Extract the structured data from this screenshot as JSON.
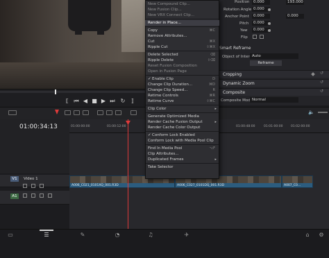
{
  "inspector": {
    "position": {
      "label": "Position",
      "x": "0.000",
      "y": "193.000"
    },
    "rotation_angle": {
      "label": "Rotation Angle",
      "value": "0.000"
    },
    "anchor_point": {
      "label": "Anchor Point",
      "x": "0.000",
      "y": "0.000"
    },
    "pitch": {
      "label": "Pitch",
      "value": "0.000"
    },
    "yaw": {
      "label": "Yaw",
      "value": "0.000"
    },
    "flip": {
      "label": "Flip"
    },
    "smart_reframe": {
      "label": "Smart Reframe"
    },
    "object_of_interest": {
      "label": "Object of Interest",
      "value": "Auto"
    },
    "reframe_button": "Reframe",
    "sections": [
      "Cropping",
      "Dynamic Zoom",
      "Composite"
    ],
    "composite_mode": {
      "label": "Composite Mode",
      "value": "Normal"
    }
  },
  "context_menu": {
    "items": [
      {
        "label": "New Compound Clip...",
        "dim": true
      },
      {
        "label": "New Fusion Clip...",
        "dim": true
      },
      {
        "label": "New VRX Connect Clip...",
        "dim": true
      },
      {
        "label": "Render in Place...",
        "highlight": true
      },
      {
        "label": "Copy",
        "shortcut": "⌘C"
      },
      {
        "label": "Remove Attributes..."
      },
      {
        "label": "Cut",
        "shortcut": "⌘X"
      },
      {
        "label": "Ripple Cut",
        "shortcut": "⇧⌘X"
      },
      {
        "label": "Delete Selected",
        "shortcut": "⌫"
      },
      {
        "label": "Ripple Delete",
        "shortcut": "⇧⌫"
      },
      {
        "label": "Reset Fusion Composition",
        "dim": true
      },
      {
        "label": "Open in Fusion Page",
        "dim": true
      },
      {
        "label": "Enable Clip",
        "checked": true,
        "shortcut": "D"
      },
      {
        "label": "Change Clip Duration...",
        "shortcut": "⌘D"
      },
      {
        "label": "Change Clip Speed...",
        "shortcut": "R"
      },
      {
        "label": "Retime Controls",
        "shortcut": "⌘R"
      },
      {
        "label": "Retime Curve",
        "shortcut": "⇧⌘C"
      },
      {
        "label": "Clip Color",
        "submenu": true
      },
      {
        "label": "Generate Optimized Media"
      },
      {
        "label": "Render Cache Fusion Output",
        "submenu": true
      },
      {
        "label": "Render Cache Color Output"
      },
      {
        "label": "Conform Lock Enabled",
        "checked": true
      },
      {
        "label": "Conform Lock with Media Pool Clip"
      },
      {
        "label": "Find In Media Pool",
        "shortcut": "⌥F"
      },
      {
        "label": "Clip Attributes..."
      },
      {
        "label": "Duplicated Frames",
        "submenu": true
      },
      {
        "label": "Take Selector"
      }
    ]
  },
  "timeline": {
    "timecode": "01:00:34:13",
    "ruler": [
      "01:00:00:00",
      "01:00:12:00",
      "01:00:36:00",
      "01:00:48:00",
      "01:01:00:00",
      "01:02:00:00"
    ],
    "video_track": {
      "tag": "V1",
      "name": "Video 1"
    },
    "audio_track": {
      "tag": "A1"
    },
    "clips": [
      {
        "name": "A006_C021_0101XQ_001.R3D"
      },
      {
        "name": "A006_C027_0101DQ_001.R3D"
      },
      {
        "name": "A007_C0..."
      }
    ]
  },
  "colors": {
    "accent": "#2c5c7e",
    "playhead": "#e03a3a",
    "menu_bg": "#2e2e32"
  }
}
